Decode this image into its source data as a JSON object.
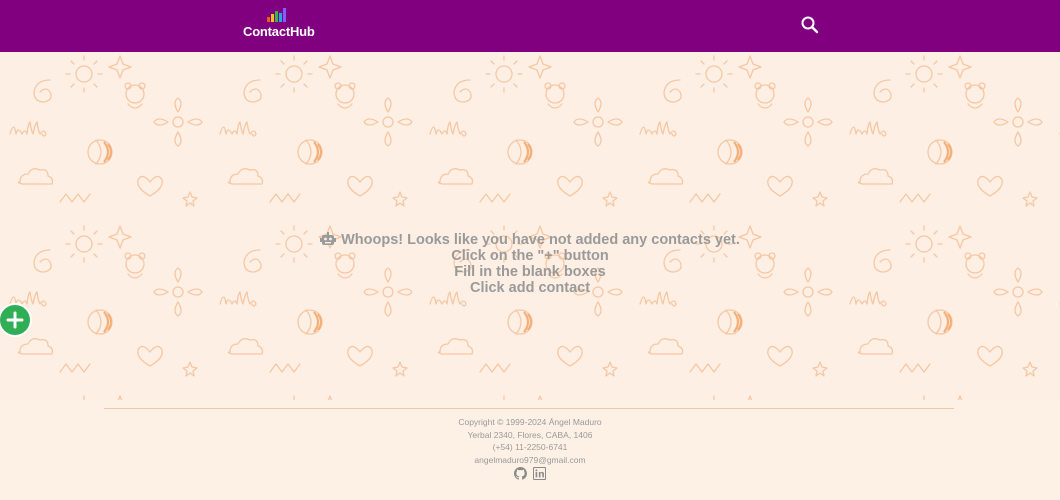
{
  "header": {
    "app_name": "ContactHub",
    "logo_icon": "bar-chart-logo-icon",
    "search_icon": "search-icon",
    "background_color": "#800080"
  },
  "main": {
    "empty_state": {
      "icon": "robot-icon",
      "line1": "Whoops! Looks like you have not added any contacts yet.",
      "line2": "Click on the \"+\" button",
      "line3": "Fill in the blank boxes",
      "line4": "Click add contact"
    },
    "add_button_icon": "plus-icon",
    "add_button_color": "#2fae56"
  },
  "footer": {
    "copyright": "Copyright © 1999-2024 Ángel Maduro",
    "address": "Yerbal 2340, Flores, CABA, 1406",
    "phone": "(+54) 11-2250-6741",
    "email": "angelmaduro979@gmail.com",
    "social_icons": [
      "github-icon",
      "linkedin-icon"
    ]
  }
}
